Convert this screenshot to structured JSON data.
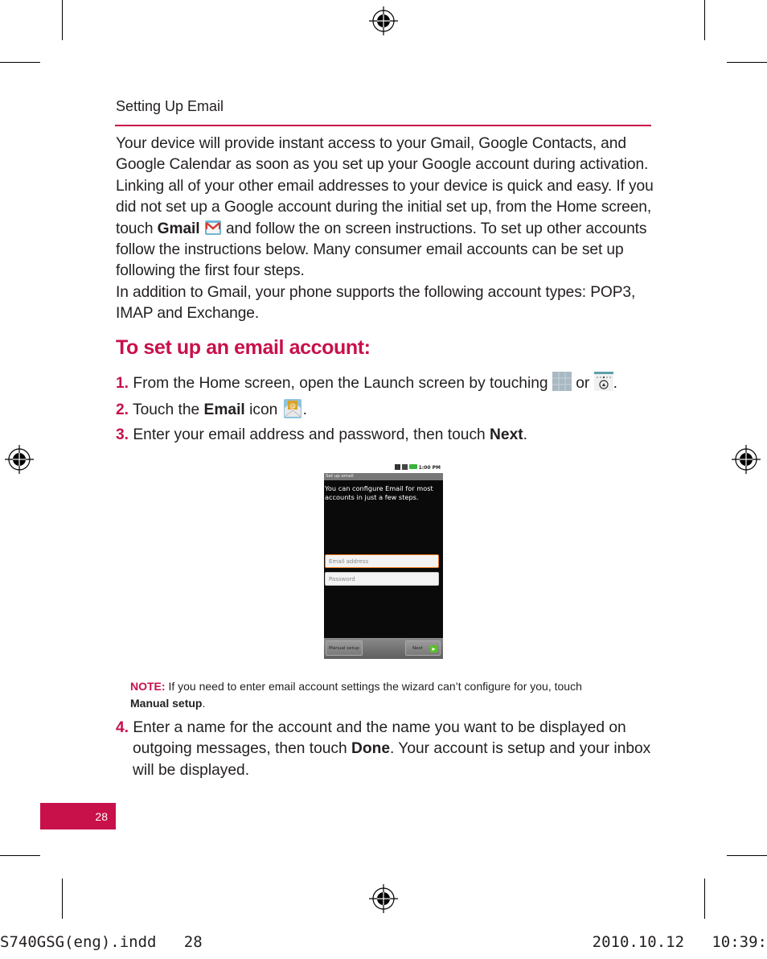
{
  "header": {
    "section_title": "Setting Up Email"
  },
  "intro": {
    "part1": "Your device will provide instant access to your Gmail, Google Contacts, and Google Calendar as soon as you set up your Google account during activation. Linking all of your other email addresses to your device is quick and easy. If you did not set up a Google account during the initial set up, from the Home screen, touch ",
    "gmail_bold": "Gmail",
    "part2": " and follow the on screen instructions. To set up other accounts follow the instructions below. Many consumer email accounts can be set up following the first four steps.",
    "part3": "In addition to Gmail, your phone supports the following account types: POP3, IMAP and Exchange."
  },
  "heading": "To set up an email account:",
  "steps": [
    {
      "num": "1.",
      "text_a": " From the Home screen, open the Launch screen by touching ",
      "or": " or ",
      "end": "."
    },
    {
      "num": "2.",
      "text_a": " Touch the ",
      "bold": "Email",
      "text_b": " icon ",
      "end": "."
    },
    {
      "num": "3.",
      "text_a": " Enter your email address and password, then touch ",
      "bold": "Next",
      "end": "."
    },
    {
      "num": "4.",
      "text_a": " Enter a name for the account and the name you want to be displayed on outgoing messages, then touch ",
      "bold": "Done",
      "text_b": ". Your account is setup and your inbox will be displayed."
    }
  ],
  "phone_screen": {
    "status_time": "1:00 PM",
    "title": "Set up email",
    "message": "You can configure Email for most accounts in just a few steps.",
    "email_placeholder": "Email address",
    "password_placeholder": "Password",
    "manual_setup_label": "Manual setup",
    "next_label": "Next"
  },
  "note": {
    "label": "NOTE:",
    "text": " If you need to enter email account settings the wizard can’t configure for you, touch ",
    "bold": "Manual setup",
    "end": "."
  },
  "page_number": "28",
  "slug": {
    "file": "S740GSG(eng).indd   28",
    "timestamp": "2010.10.12   10:39:"
  },
  "colors": {
    "accent": "#c8104a"
  }
}
